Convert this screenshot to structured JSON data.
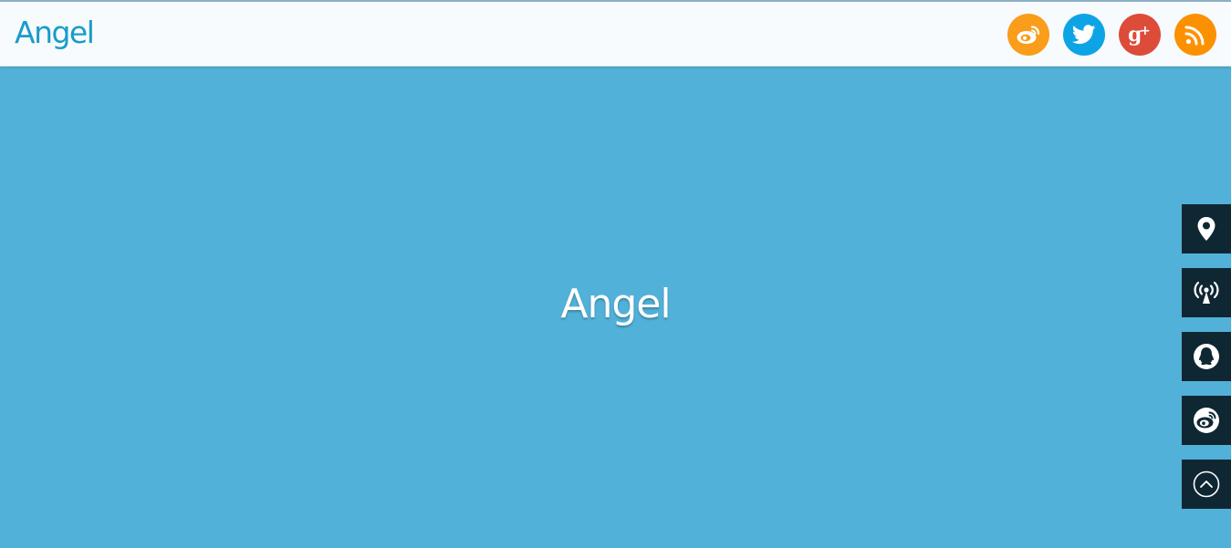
{
  "header": {
    "logo_text": "Angel",
    "social": [
      {
        "name": "weibo-icon",
        "color": "#f99d1b"
      },
      {
        "name": "twitter-icon",
        "color": "#0da4e6"
      },
      {
        "name": "google-plus-icon",
        "color": "#dd4b39"
      },
      {
        "name": "rss-icon",
        "color": "#fb9100"
      }
    ]
  },
  "hero": {
    "title": "Angel",
    "background": "#52b1d8"
  },
  "side_tools": [
    {
      "name": "location-pin-icon"
    },
    {
      "name": "broadcast-antenna-icon"
    },
    {
      "name": "qq-penguin-icon"
    },
    {
      "name": "weibo-icon"
    },
    {
      "name": "back-to-top-icon"
    }
  ]
}
